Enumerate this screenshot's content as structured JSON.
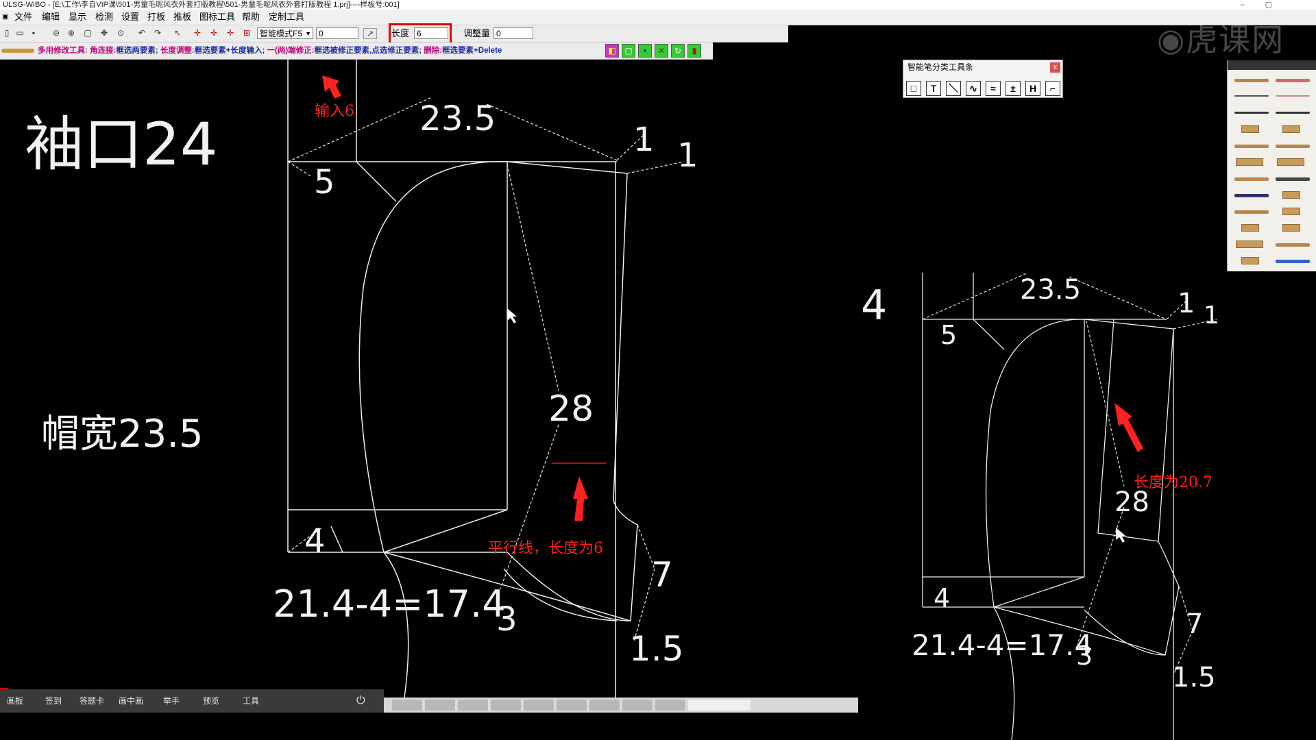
{
  "window": {
    "title": "ULSG-WIBO - [E:\\工作\\李自VIP课\\501-男童毛呢风衣外套打版教程\\501-男童毛呢风衣外套打版教程 1.prj]----样板号:001]"
  },
  "menu": [
    "文件",
    "编辑",
    "显示",
    "检测",
    "设置",
    "打板",
    "推板",
    "图标工具",
    "帮助",
    "定制工具"
  ],
  "toolbar": {
    "mode_select": "智能模式F5",
    "value_input": "0",
    "length_label": "长度",
    "length_value": "6",
    "adjust_label": "调整量",
    "adjust_value": "0"
  },
  "hintbar": {
    "segments": [
      {
        "text": "多用修改工具:",
        "accent": true
      },
      {
        "text": " 角连接:",
        "accent": true
      },
      {
        "text": "框选两要素; ",
        "accent": false
      },
      {
        "text": "长度调整:",
        "accent": true
      },
      {
        "text": "框选要素+长度输入; ",
        "accent": false
      },
      {
        "text": "一(两)端修正:",
        "accent": true
      },
      {
        "text": "框选被修正要素,点选修正要素; ",
        "accent": false
      },
      {
        "text": "删除:",
        "accent": true
      },
      {
        "text": "框选要素+Delete",
        "accent": false
      }
    ]
  },
  "palette": {
    "title": "智能笔分类工具条",
    "close": "x",
    "tools": [
      "□",
      "T",
      "＼",
      "∿",
      "≈",
      "±",
      "H",
      "⌐"
    ]
  },
  "canvas": {
    "big_labels": {
      "cuff": "袖口24",
      "hood_width": "帽宽23.5"
    },
    "left_dims": {
      "d23_5": "23.5",
      "d1a": "1",
      "d1b": "1",
      "d5": "5",
      "d28": "28",
      "d4": "4",
      "d7": "7",
      "d3": "3",
      "d1_5": "1.5",
      "formula": "21.4-4=17.4"
    },
    "right_dims": {
      "d4top": "4",
      "d23_5": "23.5",
      "d1a": "1",
      "d1b": "1",
      "d5": "5",
      "d28": "28",
      "d4": "4",
      "d7": "7",
      "d3": "3",
      "d1_5": "1.5",
      "formula": "21.4-4=17.4"
    }
  },
  "annotations": {
    "input6": "输入6",
    "parallel": "平行线，长度为6",
    "length207": "长度为20.7"
  },
  "watermark": "虎课网",
  "bottombar": {
    "items": [
      "画板",
      "签到",
      "答题卡",
      "画中画",
      "举手",
      "预览",
      "工具"
    ]
  },
  "colors": {
    "annotation_red": "#ff2020",
    "line": "#f0f0f0",
    "dashed": "#c8f0c8",
    "highlight_box": "#e00000"
  }
}
